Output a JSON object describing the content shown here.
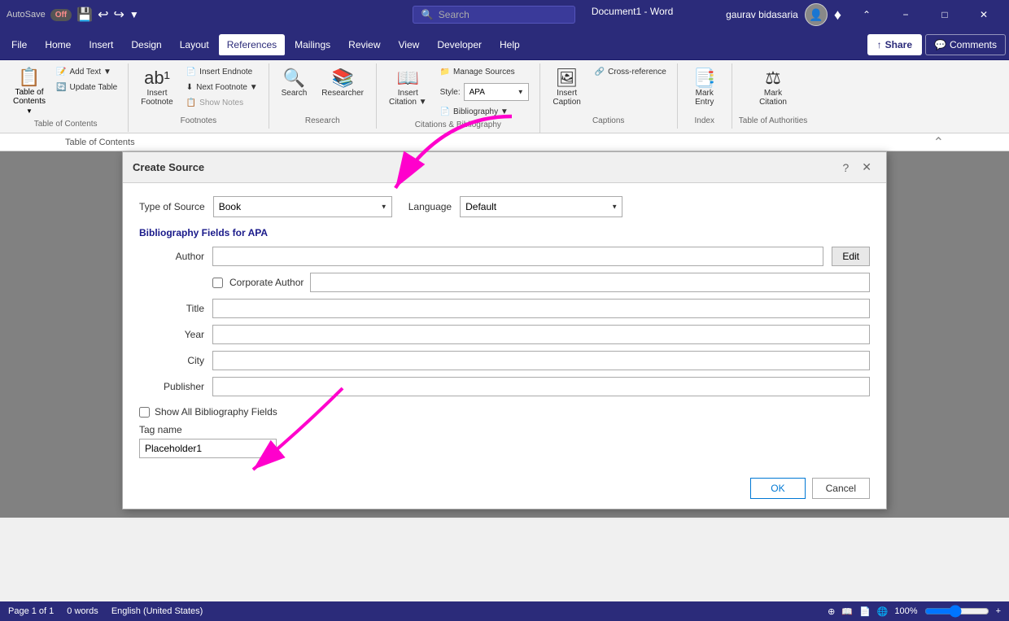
{
  "titlebar": {
    "autosave": "AutoSave",
    "off": "Off",
    "title": "Document1 - Word",
    "search_placeholder": "Search",
    "username": "gaurav bidasaria",
    "minimize": "−",
    "maximize": "□",
    "close": "✕"
  },
  "menubar": {
    "items": [
      "File",
      "Home",
      "Insert",
      "Design",
      "Layout",
      "References",
      "Mailings",
      "Review",
      "View",
      "Developer",
      "Help"
    ],
    "active": "References",
    "share": "Share",
    "comments": "Comments"
  },
  "ribbon": {
    "toc_group": {
      "label": "Table of Contents",
      "table_of_contents": "Table of\nContents",
      "add_text": "Add Text",
      "update_table": "Update Table"
    },
    "footnotes_group": {
      "label": "Footnotes",
      "insert_footnote": "Insert\nFootnote",
      "insert_endnote": "Insert Endnote",
      "next_footnote": "Next Footnote",
      "show_notes": "Show Notes"
    },
    "research_group": {
      "label": "Research",
      "search": "Search",
      "researcher": "Researcher"
    },
    "citations_group": {
      "label": "Citations & Bibliography",
      "insert_citation": "Insert\nCitation",
      "manage_sources": "Manage Sources",
      "style_label": "Style:",
      "style_value": "APA",
      "bibliography": "Bibliography"
    },
    "captions_group": {
      "label": "Captions",
      "insert_caption": "Insert\nCaption",
      "cross_ref": "Cross-reference"
    },
    "index_group": {
      "label": "Index",
      "mark_entry": "Mark\nEntry"
    },
    "toa_group": {
      "label": "Table of Authorities",
      "mark_citation": "Mark\nCitation"
    }
  },
  "dialog": {
    "title": "Create Source",
    "type_of_source_label": "Type of Source",
    "type_of_source_value": "Book",
    "language_label": "Language",
    "language_value": "Default",
    "section_header": "Bibliography Fields for APA",
    "fields": [
      {
        "label": "Author",
        "value": "",
        "has_edit": true
      },
      {
        "label": "Title",
        "value": ""
      },
      {
        "label": "Year",
        "value": ""
      },
      {
        "label": "City",
        "value": ""
      },
      {
        "label": "Publisher",
        "value": ""
      }
    ],
    "corporate_author_label": "Corporate Author",
    "show_all_label": "Show All Bibliography Fields",
    "tag_name_label": "Tag name",
    "tag_value": "Placeholder1",
    "ok": "OK",
    "cancel": "Cancel",
    "help": "?",
    "close": "✕"
  },
  "statusbar": {
    "page": "Page 1 of 1",
    "words": "0 words",
    "language": "English (United States)",
    "zoom": "100%"
  }
}
